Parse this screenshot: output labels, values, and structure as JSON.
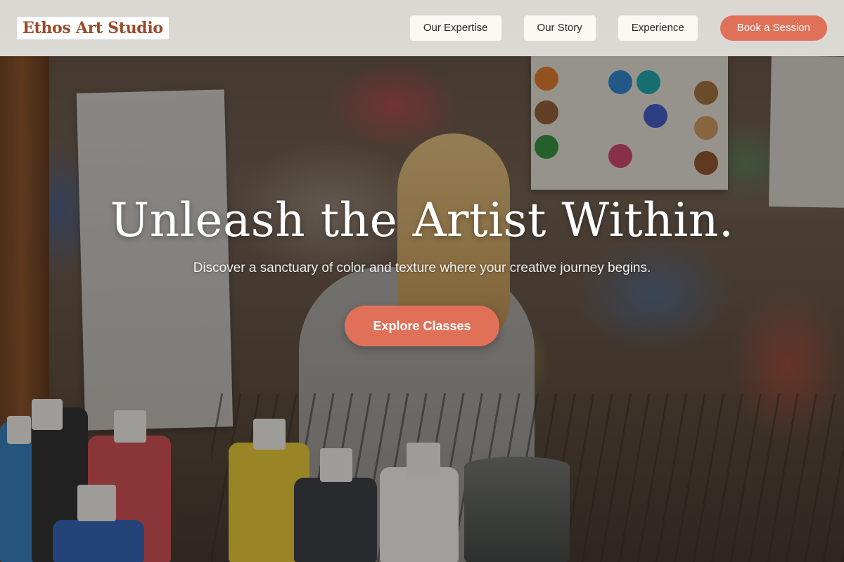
{
  "header": {
    "logo": "Ethos Art Studio",
    "nav": [
      {
        "label": "Our Expertise"
      },
      {
        "label": "Our Story"
      },
      {
        "label": "Experience"
      }
    ],
    "cta_label": "Book a Session"
  },
  "hero": {
    "title": "Unleash the Artist Within.",
    "subtitle": "Discover a sanctuary of color and texture where your creative journey begins.",
    "cta_label": "Explore Classes"
  },
  "colors": {
    "accent": "#e07158",
    "logo_text": "#9a4a2a",
    "header_bg": "#f5f3f0"
  }
}
